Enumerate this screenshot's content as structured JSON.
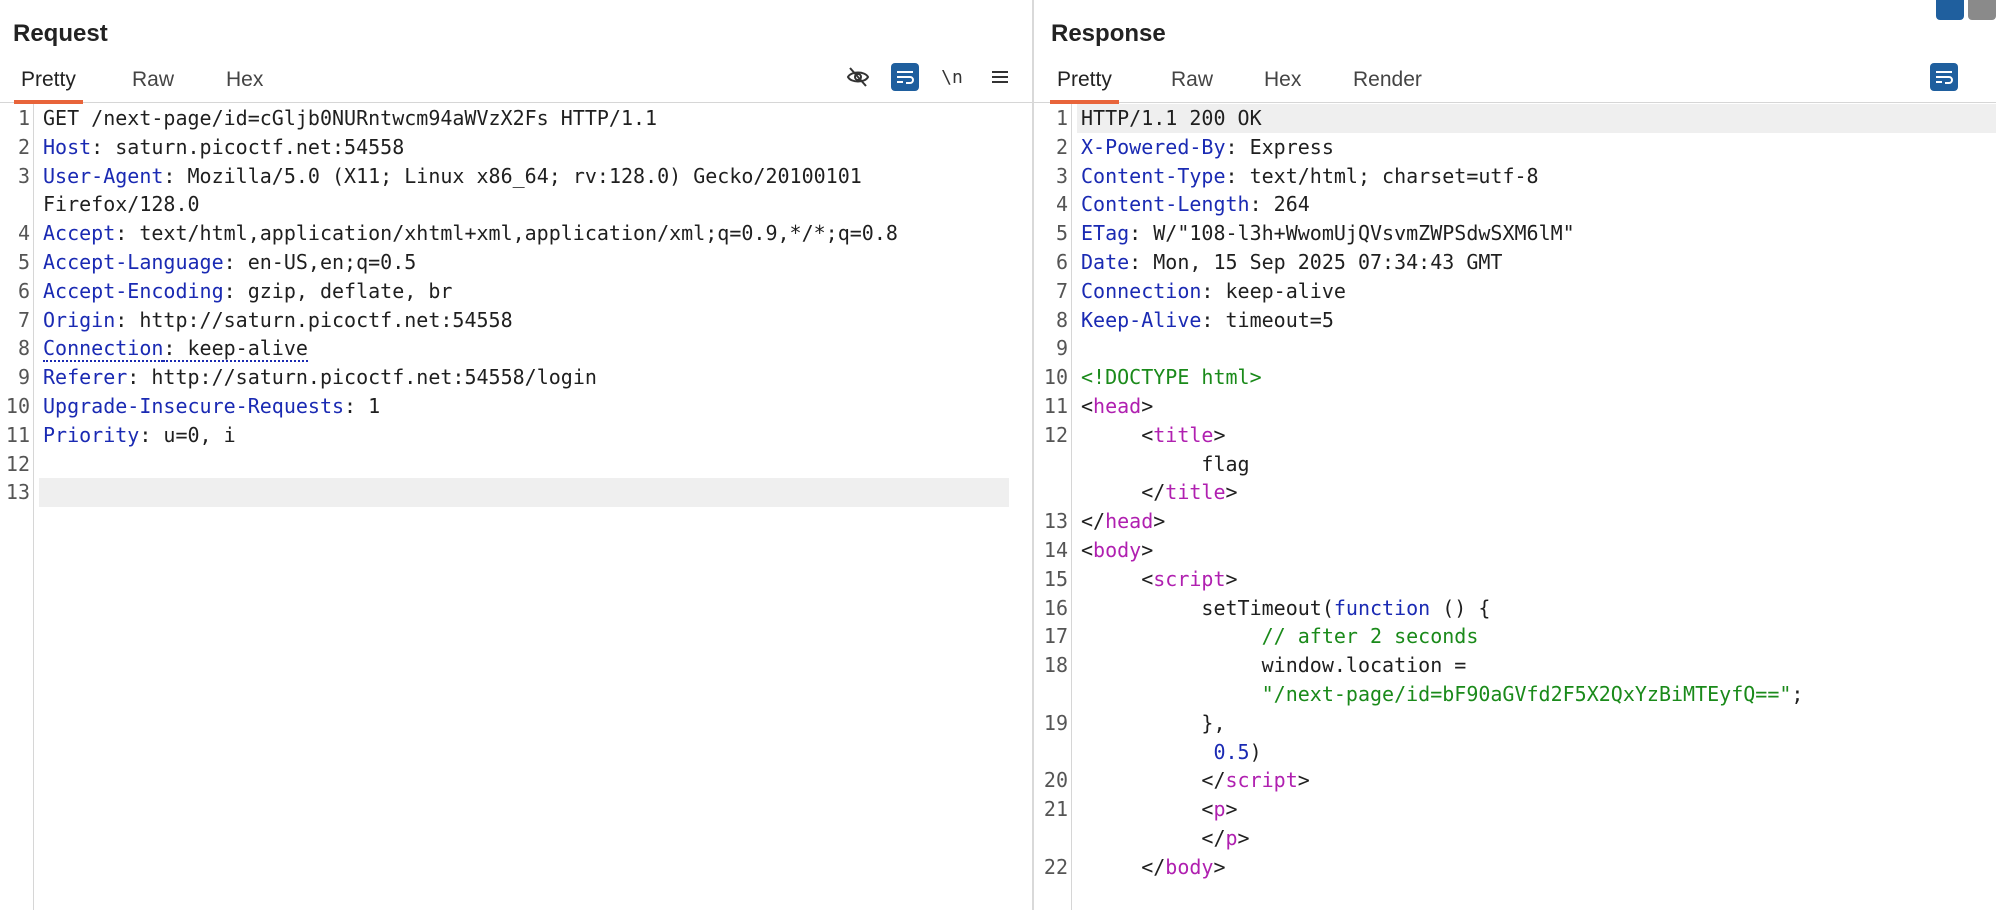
{
  "request": {
    "title": "Request",
    "tabs": [
      "Pretty",
      "Raw",
      "Hex"
    ],
    "active_tab": "Pretty",
    "toolbar": {
      "newline_label": "\\n"
    },
    "lines": [
      {
        "n": "1",
        "parts": [
          {
            "t": "GET /next-page/id=cGljb0NURntwcm94aWVzX2Fs HTTP/1.1",
            "c": ""
          }
        ]
      },
      {
        "n": "2",
        "parts": [
          {
            "t": "Host",
            "c": "hk"
          },
          {
            "t": ": saturn.picoctf.net:54558",
            "c": ""
          }
        ]
      },
      {
        "n": "3",
        "parts": [
          {
            "t": "User-Agent",
            "c": "hk"
          },
          {
            "t": ": Mozilla/5.0 (X11; Linux x86_64; rv:128.0) Gecko/20100101",
            "c": ""
          }
        ]
      },
      {
        "n": "",
        "parts": [
          {
            "t": "Firefox/128.0",
            "c": ""
          }
        ]
      },
      {
        "n": "4",
        "parts": [
          {
            "t": "Accept",
            "c": "hk"
          },
          {
            "t": ": text/html,application/xhtml+xml,application/xml;q=0.9,*/*;q=0.8",
            "c": ""
          }
        ]
      },
      {
        "n": "5",
        "parts": [
          {
            "t": "Accept-Language",
            "c": "hk"
          },
          {
            "t": ": en-US,en;q=0.5",
            "c": ""
          }
        ]
      },
      {
        "n": "6",
        "parts": [
          {
            "t": "Accept-Encoding",
            "c": "hk"
          },
          {
            "t": ": gzip, deflate, br",
            "c": ""
          }
        ]
      },
      {
        "n": "7",
        "parts": [
          {
            "t": "Origin",
            "c": "hk"
          },
          {
            "t": ": http://saturn.picoctf.net:54558",
            "c": ""
          }
        ]
      },
      {
        "n": "8",
        "parts": [
          {
            "t": "Connection",
            "c": "hk dotted"
          },
          {
            "t": ": keep-alive",
            "c": "dotted"
          }
        ]
      },
      {
        "n": "9",
        "parts": [
          {
            "t": "Referer",
            "c": "hk"
          },
          {
            "t": ": http://saturn.picoctf.net:54558/login",
            "c": ""
          }
        ]
      },
      {
        "n": "10",
        "parts": [
          {
            "t": "Upgrade-Insecure-Requests",
            "c": "hk"
          },
          {
            "t": ": 1",
            "c": ""
          }
        ]
      },
      {
        "n": "11",
        "parts": [
          {
            "t": "Priority",
            "c": "hk"
          },
          {
            "t": ": u=0, i",
            "c": ""
          }
        ]
      },
      {
        "n": "12",
        "parts": [
          {
            "t": "",
            "c": ""
          }
        ]
      },
      {
        "n": "13",
        "parts": [
          {
            "t": "",
            "c": ""
          }
        ],
        "hl": true
      }
    ]
  },
  "response": {
    "title": "Response",
    "tabs": [
      "Pretty",
      "Raw",
      "Hex",
      "Render"
    ],
    "active_tab": "Pretty",
    "lines": [
      {
        "n": "1",
        "parts": [
          {
            "t": "HTTP/1.1 200 OK",
            "c": ""
          }
        ],
        "hl": true
      },
      {
        "n": "2",
        "parts": [
          {
            "t": "X-Powered-By",
            "c": "hk"
          },
          {
            "t": ": Express",
            "c": ""
          }
        ]
      },
      {
        "n": "3",
        "parts": [
          {
            "t": "Content-Type",
            "c": "hk"
          },
          {
            "t": ": text/html; charset=utf-8",
            "c": ""
          }
        ]
      },
      {
        "n": "4",
        "parts": [
          {
            "t": "Content-Length",
            "c": "hk"
          },
          {
            "t": ": 264",
            "c": ""
          }
        ]
      },
      {
        "n": "5",
        "parts": [
          {
            "t": "ETag",
            "c": "hk"
          },
          {
            "t": ": W/\"108-l3h+WwomUjQVsvmZWPSdwSXM6lM\"",
            "c": ""
          }
        ]
      },
      {
        "n": "6",
        "parts": [
          {
            "t": "Date",
            "c": "hk"
          },
          {
            "t": ": Mon, 15 Sep 2025 07:34:43 GMT",
            "c": ""
          }
        ]
      },
      {
        "n": "7",
        "parts": [
          {
            "t": "Connection",
            "c": "hk"
          },
          {
            "t": ": keep-alive",
            "c": ""
          }
        ]
      },
      {
        "n": "8",
        "parts": [
          {
            "t": "Keep-Alive",
            "c": "hk"
          },
          {
            "t": ": timeout=5",
            "c": ""
          }
        ]
      },
      {
        "n": "9",
        "parts": [
          {
            "t": "",
            "c": ""
          }
        ]
      },
      {
        "n": "10",
        "parts": [
          {
            "t": "<!DOCTYPE html>",
            "c": "str"
          }
        ]
      },
      {
        "n": "11",
        "parts": [
          {
            "t": "<",
            "c": ""
          },
          {
            "t": "head",
            "c": "tag"
          },
          {
            "t": ">",
            "c": ""
          }
        ]
      },
      {
        "n": "12",
        "parts": [
          {
            "t": "     <",
            "c": ""
          },
          {
            "t": "title",
            "c": "tag"
          },
          {
            "t": ">",
            "c": ""
          }
        ]
      },
      {
        "n": "",
        "parts": [
          {
            "t": "          flag",
            "c": ""
          }
        ]
      },
      {
        "n": "",
        "parts": [
          {
            "t": "     </",
            "c": ""
          },
          {
            "t": "title",
            "c": "tag"
          },
          {
            "t": ">",
            "c": ""
          }
        ]
      },
      {
        "n": "13",
        "parts": [
          {
            "t": "</",
            "c": ""
          },
          {
            "t": "head",
            "c": "tag"
          },
          {
            "t": ">",
            "c": ""
          }
        ]
      },
      {
        "n": "14",
        "parts": [
          {
            "t": "<",
            "c": ""
          },
          {
            "t": "body",
            "c": "tag"
          },
          {
            "t": ">",
            "c": ""
          }
        ]
      },
      {
        "n": "15",
        "parts": [
          {
            "t": "     <",
            "c": ""
          },
          {
            "t": "script",
            "c": "tag"
          },
          {
            "t": ">",
            "c": ""
          }
        ]
      },
      {
        "n": "16",
        "parts": [
          {
            "t": "          setTimeout(",
            "c": ""
          },
          {
            "t": "function",
            "c": "kw"
          },
          {
            "t": " () {",
            "c": ""
          }
        ]
      },
      {
        "n": "17",
        "parts": [
          {
            "t": "               // after 2 seconds",
            "c": "cmt"
          }
        ]
      },
      {
        "n": "18",
        "parts": [
          {
            "t": "               window.location =",
            "c": ""
          }
        ]
      },
      {
        "n": "",
        "parts": [
          {
            "t": "               \"/next-page/id=bF90aGVfd2F5X2QxYzBiMTEyfQ==\"",
            "c": "str"
          },
          {
            "t": ";",
            "c": ""
          }
        ]
      },
      {
        "n": "19",
        "parts": [
          {
            "t": "          },",
            "c": ""
          }
        ]
      },
      {
        "n": "",
        "parts": [
          {
            "t": "           ",
            "c": ""
          },
          {
            "t": "0.5",
            "c": "num"
          },
          {
            "t": ")",
            "c": ""
          }
        ]
      },
      {
        "n": "20",
        "parts": [
          {
            "t": "          </",
            "c": ""
          },
          {
            "t": "script",
            "c": "tag"
          },
          {
            "t": ">",
            "c": ""
          }
        ]
      },
      {
        "n": "21",
        "parts": [
          {
            "t": "          <",
            "c": ""
          },
          {
            "t": "p",
            "c": "tag"
          },
          {
            "t": ">",
            "c": ""
          }
        ]
      },
      {
        "n": "",
        "parts": [
          {
            "t": "          </",
            "c": ""
          },
          {
            "t": "p",
            "c": "tag"
          },
          {
            "t": ">",
            "c": ""
          }
        ]
      },
      {
        "n": "22",
        "parts": [
          {
            "t": "     </",
            "c": ""
          },
          {
            "t": "body",
            "c": "tag"
          },
          {
            "t": ">",
            "c": ""
          }
        ]
      }
    ]
  },
  "colors": {
    "accent": "#e8643a",
    "button_blue": "#1f5f9e",
    "header_key": "#1a2ab3",
    "tag": "#b020b0",
    "string": "#1a8a1a"
  }
}
